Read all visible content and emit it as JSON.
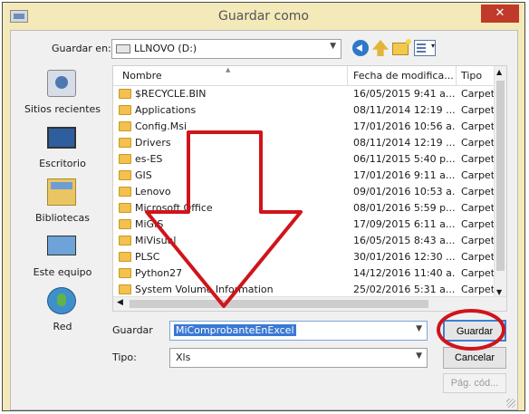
{
  "window": {
    "title": "Guardar como",
    "close_label": "✕"
  },
  "toolbar": {
    "save_in_label": "Guardar en:",
    "location": "LLNOVO (D:)"
  },
  "places": [
    {
      "label": "Sitios recientes",
      "icon": "recent-places-icon"
    },
    {
      "label": "Escritorio",
      "icon": "desktop-icon"
    },
    {
      "label": "Bibliotecas",
      "icon": "libraries-icon"
    },
    {
      "label": "Este equipo",
      "icon": "computer-icon"
    },
    {
      "label": "Red",
      "icon": "network-icon"
    }
  ],
  "filelist": {
    "columns": {
      "name": "Nombre",
      "date": "Fecha de modifica...",
      "type": "Tipo"
    },
    "rows": [
      {
        "name": "$RECYCLE.BIN",
        "date": "16/05/2015 9:41 a...",
        "type": "Carpet"
      },
      {
        "name": "Applications",
        "date": "08/11/2014 12:19 ...",
        "type": "Carpet"
      },
      {
        "name": "Config.Msi",
        "date": "17/01/2016 10:56 a...",
        "type": "Carpet"
      },
      {
        "name": "Drivers",
        "date": "08/11/2014 12:19 ...",
        "type": "Carpet"
      },
      {
        "name": "es-ES",
        "date": "06/11/2015 5:40 p...",
        "type": "Carpet"
      },
      {
        "name": "GIS",
        "date": "17/01/2016 9:11 a...",
        "type": "Carpet"
      },
      {
        "name": "Lenovo",
        "date": "09/01/2016 10:53 a...",
        "type": "Carpet"
      },
      {
        "name": "Microsoft Office",
        "date": "08/01/2016 5:59 p...",
        "type": "Carpet"
      },
      {
        "name": "MiGIS",
        "date": "17/09/2015 6:11 a...",
        "type": "Carpet"
      },
      {
        "name": "MiVisual",
        "date": "16/05/2015 8:43 a...",
        "type": "Carpet"
      },
      {
        "name": "PLSC",
        "date": "30/01/2016 12:30 ...",
        "type": "Carpet"
      },
      {
        "name": "Python27",
        "date": "14/12/2016 11:40 a...",
        "type": "Carpet"
      },
      {
        "name": "System Volume Information",
        "date": "25/02/2016 5:31 a...",
        "type": "Carpet"
      }
    ]
  },
  "form": {
    "filename_label": "Guardar",
    "filename_value": "MiComprobanteEnExcel",
    "type_label": "Tipo:",
    "type_value": "Xls",
    "save_label": "Guardar",
    "cancel_label": "Cancelar",
    "page_setup_label": "Pág. cód..."
  },
  "annotation_colors": {
    "arrow": "#d0141b",
    "circle": "#d0141b"
  }
}
